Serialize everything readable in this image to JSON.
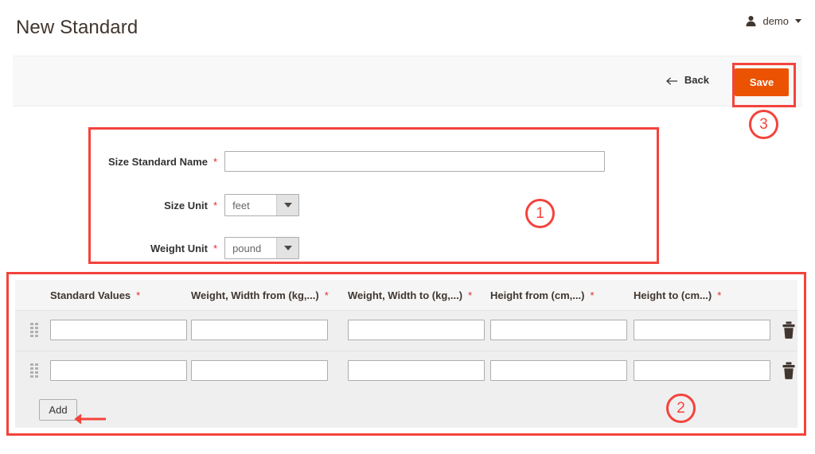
{
  "header": {
    "title": "New Standard",
    "user": {
      "icon": "user-icon",
      "name": "demo",
      "caret": "chevron-down-icon"
    }
  },
  "toolbar": {
    "back_icon": "arrow-left-icon",
    "back_label": "Back",
    "save_label": "Save"
  },
  "form": {
    "fields": [
      {
        "label": "Size Standard Name",
        "required": "*",
        "type": "text",
        "value": "",
        "placeholder": ""
      },
      {
        "label": "Size Unit",
        "required": "*",
        "type": "select",
        "value": "feet"
      },
      {
        "label": "Weight Unit",
        "required": "*",
        "type": "select",
        "value": "pound"
      }
    ]
  },
  "grid": {
    "columns": [
      {
        "label": "Standard Values",
        "required": "*"
      },
      {
        "label": "Weight, Width from (kg,...)",
        "required": "*"
      },
      {
        "label": "Weight, Width to (kg,...)",
        "required": "*"
      },
      {
        "label": "Height from (cm,...)",
        "required": "*"
      },
      {
        "label": "Height to (cm...)",
        "required": "*"
      }
    ],
    "rows": [
      {
        "drag": "drag-handle-icon",
        "cells": [
          "",
          "",
          "",
          "",
          ""
        ],
        "delete": "trash-icon"
      },
      {
        "drag": "drag-handle-icon",
        "cells": [
          "",
          "",
          "",
          "",
          ""
        ],
        "delete": "trash-icon"
      }
    ],
    "add_label": "Add"
  },
  "annotations": {
    "accent_color": "#f4433c",
    "markers": [
      {
        "id": "1",
        "target": "basic-fieldset"
      },
      {
        "id": "2",
        "target": "standard-values-grid"
      },
      {
        "id": "3",
        "target": "save-button"
      }
    ],
    "arrow": {
      "points_to": "add-button"
    }
  },
  "colors": {
    "save_orange": "#eb5202",
    "required_red": "#e02b27",
    "title_brown": "#41362f"
  }
}
